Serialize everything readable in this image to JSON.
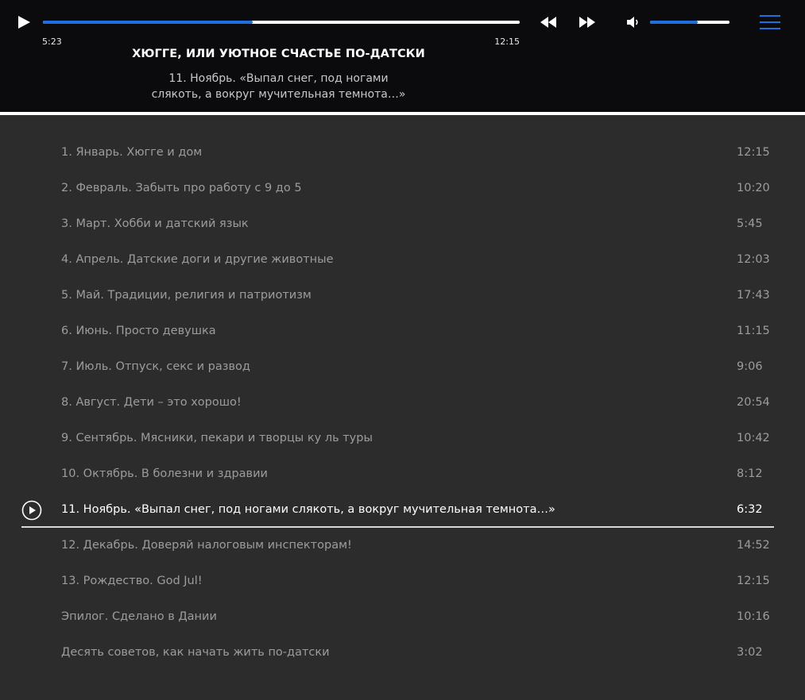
{
  "player": {
    "elapsed": "5:23",
    "total": "12:15",
    "progress_fraction": 0.44,
    "volume_fraction": 0.6,
    "book_title": "ХЮГГЕ, ИЛИ УЮТНОЕ СЧАСТЬЕ ПО-ДАТСКИ",
    "chapter_title": "11. Ноябрь. «Выпал снег, под ногами слякоть, а вокруг мучительная темнота…»",
    "icons": {
      "play": "play-icon",
      "rewind": "rewind-icon",
      "forward": "fast-forward-icon",
      "volume": "volume-icon",
      "menu": "hamburger-menu-icon"
    }
  },
  "colors": {
    "accent": "#1e6fe0",
    "header_bg": "#0b0b0d",
    "list_bg": "#2c2c2d",
    "inactive_text": "#9c9c9c",
    "active_text": "#ffffff"
  },
  "playlist": {
    "active_index": 10,
    "tracks": [
      {
        "title": "1. Январь. Хюгге и дом",
        "duration": "12:15"
      },
      {
        "title": "2. Февраль. Забыть про работу с 9 до 5",
        "duration": "10:20"
      },
      {
        "title": "3. Март. Хобби и датский язык",
        "duration": "5:45"
      },
      {
        "title": "4. Апрель. Датские доги и другие животные",
        "duration": "12:03"
      },
      {
        "title": "5. Май. Традиции, религия и патриотизм",
        "duration": "17:43"
      },
      {
        "title": "6. Июнь. Просто девушка",
        "duration": "11:15"
      },
      {
        "title": "7. Июль. Отпуск, секс и развод",
        "duration": "9:06"
      },
      {
        "title": "8. Август. Дети – это хорошо!",
        "duration": "20:54"
      },
      {
        "title": "9. Сентябрь. Мясники, пекари и творцы ку ль туры",
        "duration": "10:42"
      },
      {
        "title": "10. Октябрь. В болезни и здравии",
        "duration": "8:12"
      },
      {
        "title": "11. Ноябрь. «Выпал снег, под ногами слякоть, а вокруг мучительная темнота…»",
        "duration": "6:32"
      },
      {
        "title": "12. Декабрь. Доверяй налоговым инспекторам!",
        "duration": "14:52"
      },
      {
        "title": "13. Рождество. God Jul!",
        "duration": "12:15"
      },
      {
        "title": "Эпилог. Сделано в Дании",
        "duration": "10:16"
      },
      {
        "title": "Десять советов, как начать жить по-датски",
        "duration": "3:02"
      }
    ]
  }
}
